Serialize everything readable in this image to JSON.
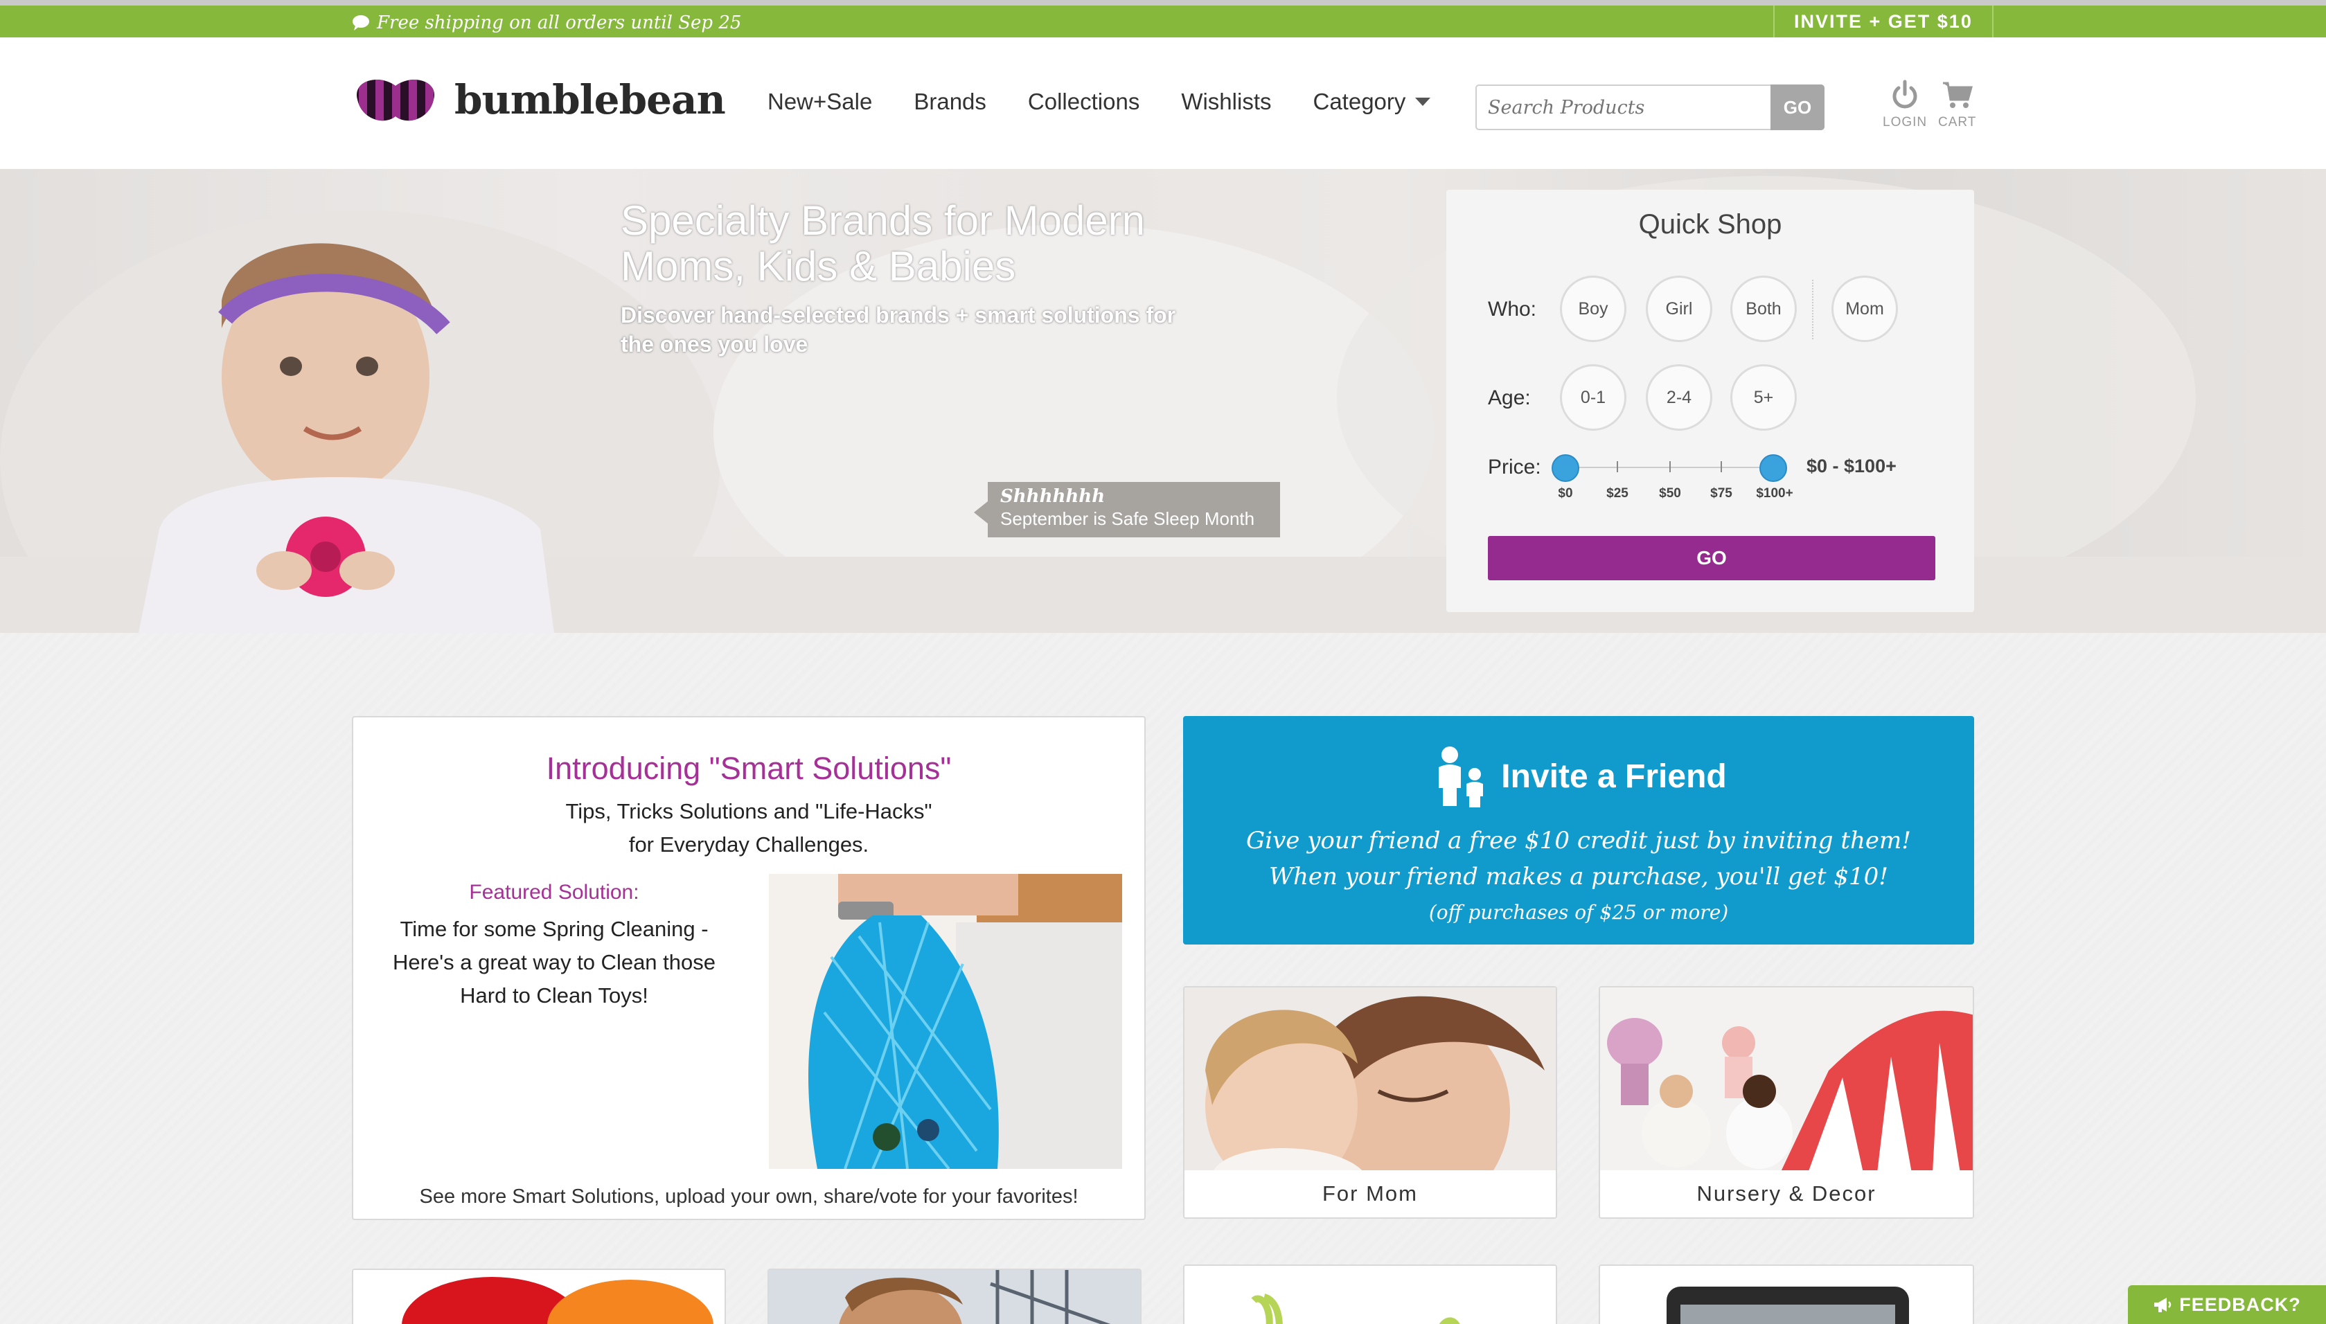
{
  "promo": {
    "shipping": "Free shipping on all orders until Sep 25",
    "invite": "INVITE + GET $10",
    "color": "#86b83b"
  },
  "header": {
    "logo_text": "bumblebean",
    "nav": [
      "New+Sale",
      "Brands",
      "Collections",
      "Wishlists",
      "Category"
    ],
    "search_placeholder": "Search Products",
    "search_button": "GO",
    "login": "LOGIN",
    "cart": "CART"
  },
  "hero": {
    "title": "Specialty Brands for Modern Moms, Kids & Babies",
    "subtitle": "Discover hand-selected brands + smart solutions for the ones you love",
    "tooltip_title": "Shhhhhhh",
    "tooltip_text": "September is Safe Sleep Month"
  },
  "quick_shop": {
    "title": "Quick Shop",
    "who_label": "Who:",
    "who": [
      "Boy",
      "Girl",
      "Both",
      "Mom"
    ],
    "age_label": "Age:",
    "age": [
      "0-1",
      "2-4",
      "5+"
    ],
    "price_label": "Price:",
    "price_ticks": [
      "$0",
      "$25",
      "$50",
      "$75",
      "$100+"
    ],
    "price_range": "$0 - $100+",
    "go": "GO",
    "accent": "#952a8f",
    "slider_color": "#3aa2dd"
  },
  "smart_solutions": {
    "title": "Introducing \"Smart Solutions\"",
    "subtitle_1": "Tips, Tricks Solutions and \"Life-Hacks\"",
    "subtitle_2": "for Everyday Challenges.",
    "featured_label": "Featured Solution:",
    "featured_1": "Time for some Spring Cleaning -",
    "featured_2": "Here's a great way to Clean those",
    "featured_3": "Hard to Clean Toys!",
    "more": "See more Smart Solutions, upload your own, share/vote for your favorites!"
  },
  "invite_card": {
    "title": "Invite a Friend",
    "line_1": "Give your friend a free $10 credit just by inviting them!",
    "line_2": "When your friend makes a purchase, you'll get $10!",
    "line_3": "(off purchases of $25 or more)",
    "color": "#119bcc"
  },
  "tiles": {
    "mom": "For Mom",
    "nursery": "Nursery & Decor"
  },
  "feedback": "FEEDBACK?"
}
